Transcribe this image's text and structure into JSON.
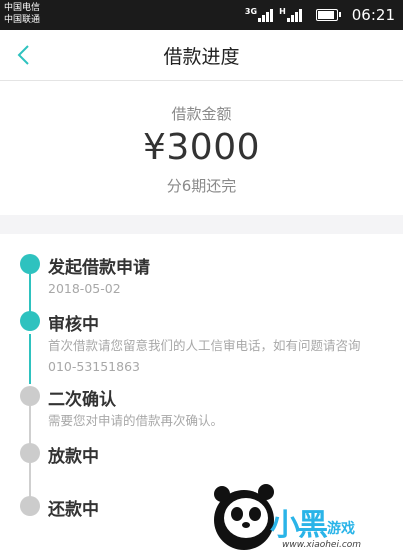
{
  "status_bar": {
    "carrier_1": "中国电信",
    "carrier_2": "中国联通",
    "net_type_1": "3G",
    "net_type_2": "H",
    "time": "06:21",
    "battery_level": 0.82
  },
  "header": {
    "title": "借款进度",
    "back_icon": "chevron-left-icon"
  },
  "loan": {
    "amount_label": "借款金额",
    "amount_value": "¥3000",
    "installments_text": "分6期还完"
  },
  "timeline": {
    "steps": [
      {
        "title": "发起借款申请",
        "subtitle": "2018-05-02",
        "state": "done"
      },
      {
        "title": "审核中",
        "subtitle": "首次借款请您留意我们的人工信审电话，如有问题请咨询 010-53151863",
        "state": "current"
      },
      {
        "title": "二次确认",
        "subtitle": "需要您对申请的借款再次确认。",
        "state": "pending"
      },
      {
        "title": "放款中",
        "subtitle": "",
        "state": "pending"
      },
      {
        "title": "还款中",
        "subtitle": "",
        "state": "pending"
      }
    ]
  },
  "watermark": {
    "brand": "小黑",
    "tag": "游戏",
    "url": "www.xiaohei.com"
  },
  "colors": {
    "accent": "#2ec2bf",
    "inactive": "#cccccc",
    "status_bar": "#1b1b1b",
    "watermark": "#2ab4e8"
  }
}
